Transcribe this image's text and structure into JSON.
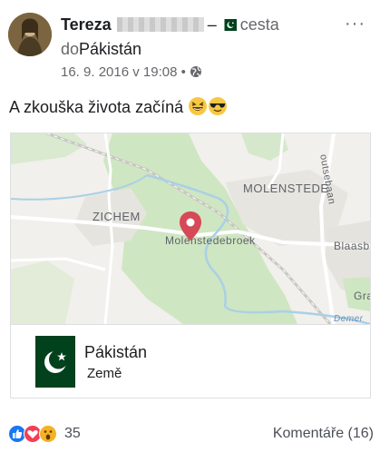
{
  "post": {
    "author_name": "Tereza",
    "activity": "cesta",
    "place_prefix": "do",
    "place": "Pákistán",
    "timestamp": "16. 9. 2016 v 19:08",
    "separator": "•",
    "more_label": "···",
    "status_text": "A zkouška života začíná"
  },
  "map": {
    "labels": {
      "zichem": "ZICHEM",
      "molenstede": "MOLENSTEDE",
      "molenstedebroek": "Molenstedebroek",
      "blaasb": "Blaasbe",
      "gra": "Gra",
      "demer": "Demer",
      "road": "outsebaan"
    },
    "pin_color": "#d64957"
  },
  "place_card": {
    "title": "Pákistán",
    "subtitle": "Země",
    "flag_green": "#01411c"
  },
  "footer": {
    "reaction_icons": [
      "like-icon",
      "love-icon",
      "wow-icon"
    ],
    "reaction_count": "35",
    "comments_label": "Komentáře (16)"
  },
  "colors": {
    "text": "#1c1e21",
    "secondary": "#65676b",
    "like_blue": "#1877f2",
    "love_red": "#f33e58",
    "wow_yellow": "#f7b125",
    "forest_green": "#cfe6c2"
  }
}
